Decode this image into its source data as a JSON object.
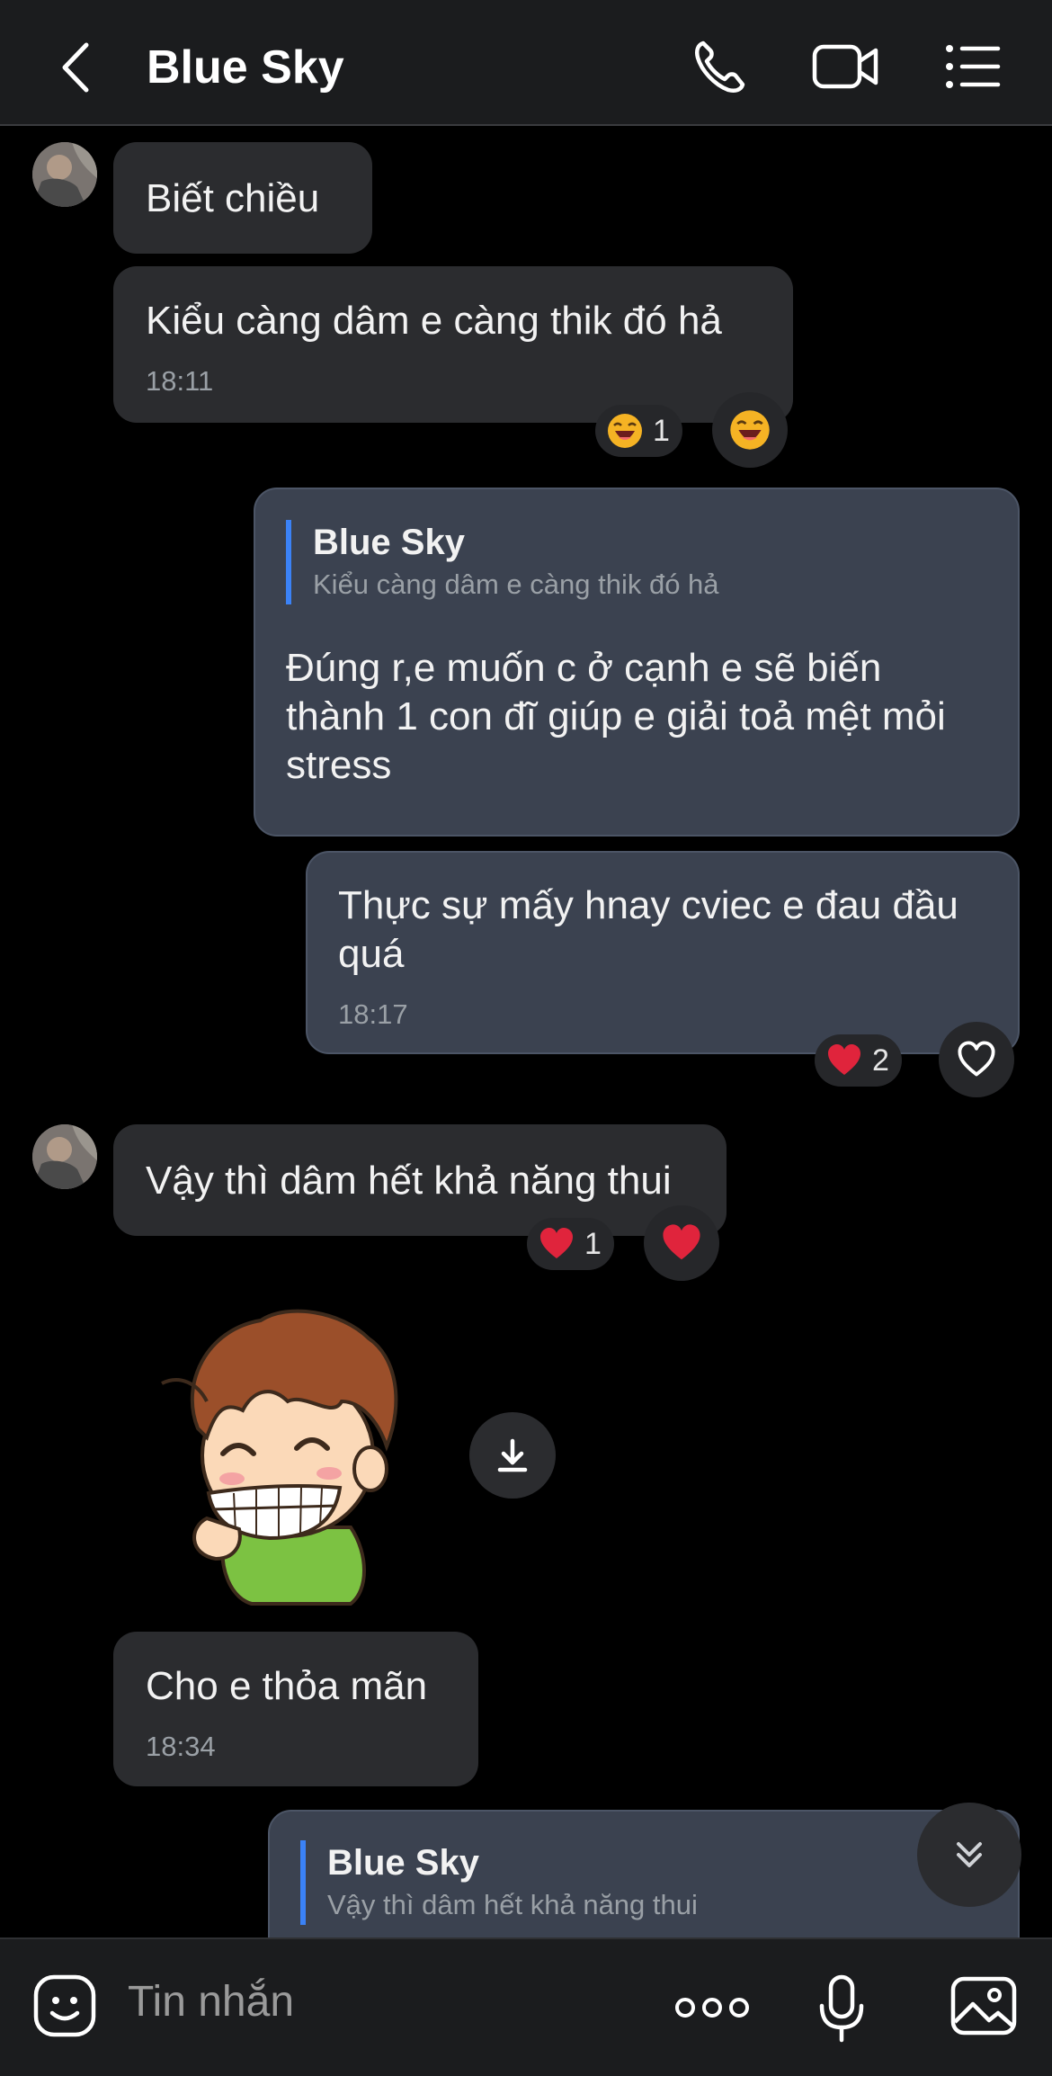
{
  "header": {
    "title": "Blue Sky",
    "back_icon": "chevron-left-icon",
    "call_icon": "phone-icon",
    "video_icon": "video-camera-icon",
    "menu_icon": "list-menu-icon"
  },
  "messages": [
    {
      "sender": "Blue Sky",
      "text": "Biết chiều"
    },
    {
      "sender": "Blue Sky",
      "text": "Kiểu càng dâm e càng thik đó hả",
      "time": "18:11",
      "reaction": {
        "emoji": "laughing-face",
        "count": "1"
      }
    },
    {
      "sender": "me",
      "reply_to": {
        "name": "Blue Sky",
        "text": "Kiểu càng dâm e càng thik đó hả"
      },
      "lines": [
        "Đúng r,e muốn c ở cạnh e sẽ biến",
        "thành 1 con đĩ giúp e giải toả mệt mỏi",
        "stress"
      ]
    },
    {
      "sender": "me",
      "lines": [
        "Thực sự mấy hnay cviec e đau đầu",
        "quá"
      ],
      "time": "18:17",
      "reaction": {
        "emoji": "red-heart",
        "count": "2"
      }
    },
    {
      "sender": "Blue Sky",
      "text": "Vậy thì dâm hết khả năng thui",
      "reaction": {
        "emoji": "red-heart",
        "count": "1"
      }
    },
    {
      "sender": "Blue Sky",
      "sticker": "cartoon-boy-grinning-sticker"
    },
    {
      "sender": "Blue Sky",
      "text": "Cho e thỏa mãn",
      "time": "18:34"
    },
    {
      "sender": "me",
      "reply_to": {
        "name": "Blue Sky",
        "text": "Vậy thì dâm hết khả năng thui"
      }
    }
  ],
  "composer": {
    "placeholder": "Tin nhắn",
    "emoji_icon": "sticker-face-icon",
    "more_icon": "more-dots-icon",
    "mic_icon": "microphone-icon",
    "image_icon": "image-icon"
  },
  "colors": {
    "background": "#000000",
    "incoming_bubble": "#2b2c2f",
    "outgoing_bubble": "#3b4250",
    "quote_accent": "#3b82f6",
    "heart": "#e0243c"
  }
}
